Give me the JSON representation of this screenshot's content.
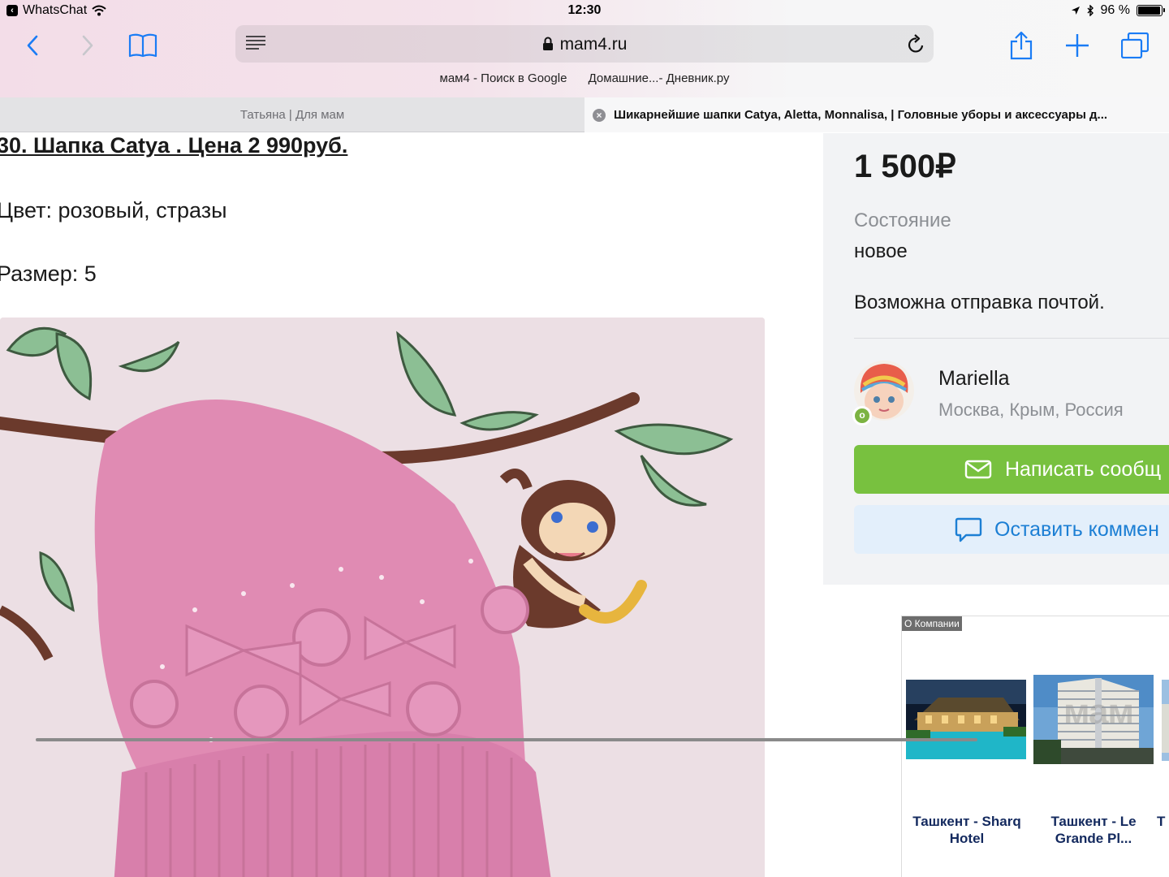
{
  "status_bar": {
    "back_app": "WhatsChat",
    "time": "12:30",
    "battery_text": "96 %",
    "battery_level": 0.96
  },
  "browser": {
    "url": "mam4.ru",
    "favorites": [
      "мам4 - Поиск в Google",
      "Домашние...- Дневник.ру"
    ],
    "tabs": [
      {
        "title": "Татьяна | Для мам",
        "active": false
      },
      {
        "title": "Шикарнейшие шапки Catya, Aletta, Monnalisa, | Головные уборы и аксессуары д...",
        "active": true
      }
    ]
  },
  "post": {
    "title": "30. Шапка Catya . Цена 2 990руб.",
    "color_line": "Цвет: розовый, стразы",
    "size_line": "Размер: 5"
  },
  "listing": {
    "price": "1 500₽",
    "condition_label": "Состояние",
    "condition_value": "новое",
    "shipping": "Возможна отправка почтой.",
    "seller": {
      "name": "Mariella",
      "location": "Москва, Крым, Россия",
      "online_badge": "o"
    },
    "message_button": "Написать сообщ",
    "comment_button": "Оставить коммен"
  },
  "ad": {
    "tag": "О Компании",
    "hotels": [
      {
        "caption": "Ташкент - Sharq Hotel"
      },
      {
        "caption": "Ташкент - Le Grande Pl..."
      },
      {
        "caption": "Т"
      }
    ]
  },
  "watermark": "мам",
  "colors": {
    "accent_green": "#78c13f",
    "link_blue": "#1c7fd4",
    "ios_blue": "#1a7cf5"
  }
}
